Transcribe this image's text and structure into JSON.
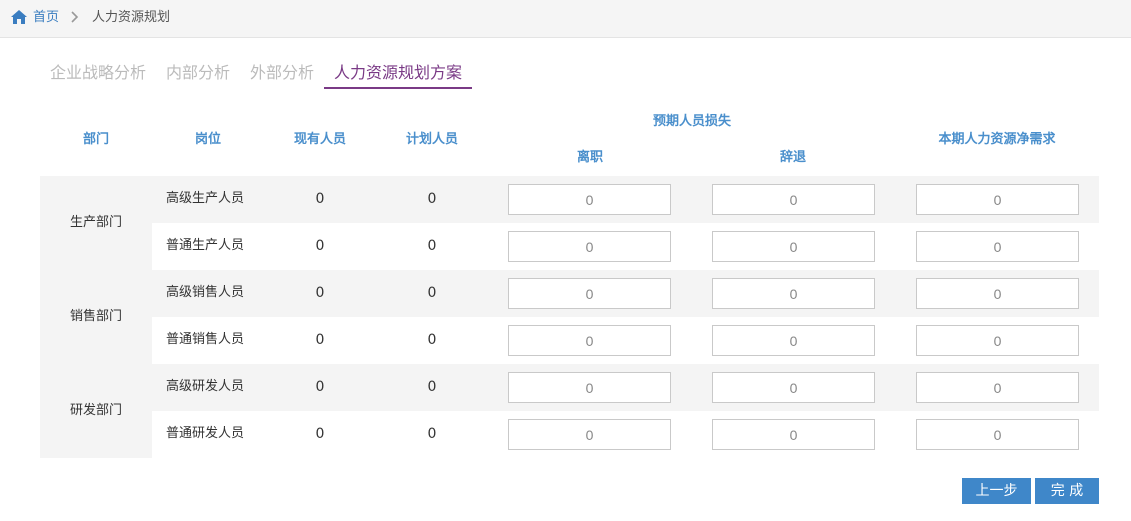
{
  "breadcrumb": {
    "home": "首页",
    "current": "人力资源规划"
  },
  "tabs": [
    "企业战略分析",
    "内部分析",
    "外部分析",
    "人力资源规划方案"
  ],
  "active_tab": 3,
  "table": {
    "headers": {
      "department": "部门",
      "position": "岗位",
      "existing": "现有人员",
      "planned": "计划人员",
      "expected_loss": "预期人员损失",
      "resign": "离职",
      "quit": "辞退",
      "net_demand": "本期人力资源净需求"
    },
    "departments": [
      {
        "name": "生产部门",
        "rows": [
          {
            "position": "高级生产人员",
            "existing": "0",
            "planned": "0",
            "resign": "0",
            "quit": "0",
            "net": "0"
          },
          {
            "position": "普通生产人员",
            "existing": "0",
            "planned": "0",
            "resign": "0",
            "quit": "0",
            "net": "0"
          }
        ]
      },
      {
        "name": "销售部门",
        "rows": [
          {
            "position": "高级销售人员",
            "existing": "0",
            "planned": "0",
            "resign": "0",
            "quit": "0",
            "net": "0"
          },
          {
            "position": "普通销售人员",
            "existing": "0",
            "planned": "0",
            "resign": "0",
            "quit": "0",
            "net": "0"
          }
        ]
      },
      {
        "name": "研发部门",
        "rows": [
          {
            "position": "高级研发人员",
            "existing": "0",
            "planned": "0",
            "resign": "0",
            "quit": "0",
            "net": "0"
          },
          {
            "position": "普通研发人员",
            "existing": "0",
            "planned": "0",
            "resign": "0",
            "quit": "0",
            "net": "0"
          }
        ]
      }
    ]
  },
  "buttons": {
    "prev": "上一步",
    "finish": "完 成"
  },
  "colors": {
    "accent": "#3f87c9",
    "header_text": "#4a8fcc",
    "active_tab": "#7a3a86",
    "row_stripe": "#f4f4f4"
  },
  "icons": {
    "home": "home-icon",
    "separator": "chevron-right-icon"
  }
}
